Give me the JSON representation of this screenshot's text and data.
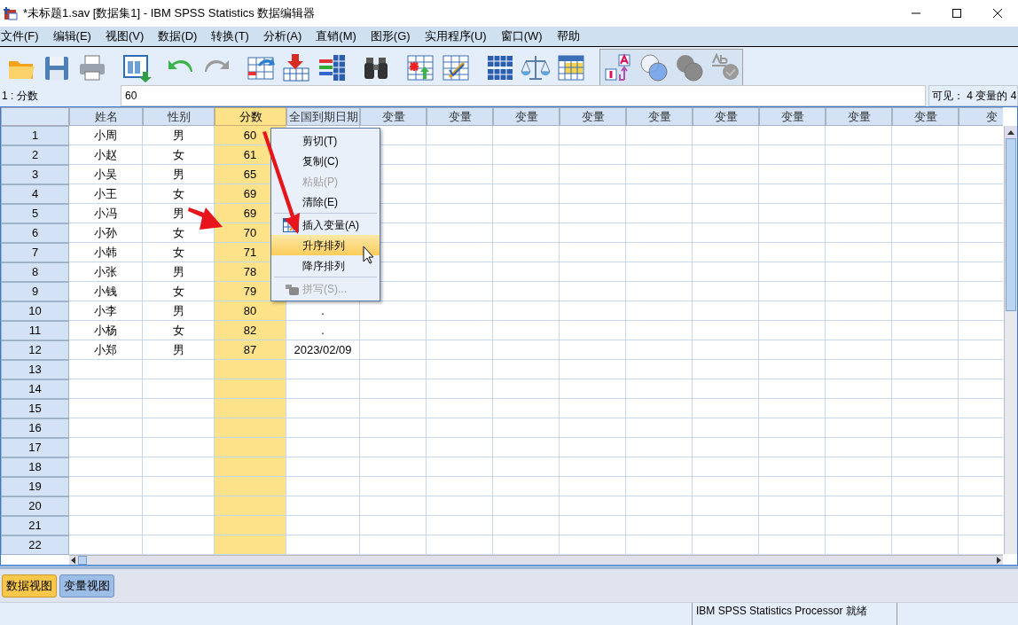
{
  "window": {
    "title": "*未标题1.sav [数据集1] - IBM SPSS Statistics 数据编辑器"
  },
  "menu_bar": [
    "文件(F)",
    "编辑(E)",
    "视图(V)",
    "数据(D)",
    "转换(T)",
    "分析(A)",
    "直销(M)",
    "图形(G)",
    "实用程序(U)",
    "窗口(W)",
    "帮助"
  ],
  "cell_editor": {
    "cell_reference": "1 : 分数",
    "value": "60",
    "visible_count": "可见： 4 变量的 4"
  },
  "grid": {
    "columns": [
      {
        "label": "姓名",
        "selected": false
      },
      {
        "label": "性别",
        "selected": false
      },
      {
        "label": "分数",
        "selected": true
      },
      {
        "label": "全国到期日期",
        "selected": false
      },
      {
        "label": "变量",
        "selected": false
      },
      {
        "label": "变量",
        "selected": false
      },
      {
        "label": "变量",
        "selected": false
      },
      {
        "label": "变量",
        "selected": false
      },
      {
        "label": "变量",
        "selected": false
      },
      {
        "label": "变量",
        "selected": false
      },
      {
        "label": "变量",
        "selected": false
      },
      {
        "label": "变量",
        "selected": false
      },
      {
        "label": "变量",
        "selected": false
      },
      {
        "label": "变",
        "selected": false
      }
    ],
    "rows": [
      {
        "number": "1",
        "cells": [
          "小周",
          "男",
          "60"
        ]
      },
      {
        "number": "2",
        "cells": [
          "小赵",
          "女",
          "61"
        ]
      },
      {
        "number": "3",
        "cells": [
          "小吴",
          "男",
          "65"
        ]
      },
      {
        "number": "4",
        "cells": [
          "小王",
          "女",
          "69"
        ]
      },
      {
        "number": "5",
        "cells": [
          "小冯",
          "男",
          "69"
        ]
      },
      {
        "number": "6",
        "cells": [
          "小孙",
          "女",
          "70"
        ]
      },
      {
        "number": "7",
        "cells": [
          "小韩",
          "女",
          "71"
        ]
      },
      {
        "number": "8",
        "cells": [
          "小张",
          "男",
          "78"
        ]
      },
      {
        "number": "9",
        "cells": [
          "小钱",
          "女",
          "79"
        ]
      },
      {
        "number": "10",
        "cells": [
          "小李",
          "男",
          "80",
          "."
        ]
      },
      {
        "number": "11",
        "cells": [
          "小杨",
          "女",
          "82",
          "."
        ]
      },
      {
        "number": "12",
        "cells": [
          "小郑",
          "男",
          "87",
          "2023/02/09"
        ]
      },
      {
        "number": "13",
        "cells": []
      },
      {
        "number": "14",
        "cells": []
      },
      {
        "number": "15",
        "cells": []
      },
      {
        "number": "16",
        "cells": []
      },
      {
        "number": "17",
        "cells": []
      },
      {
        "number": "18",
        "cells": []
      },
      {
        "number": "19",
        "cells": []
      },
      {
        "number": "20",
        "cells": []
      },
      {
        "number": "21",
        "cells": []
      },
      {
        "number": "22",
        "cells": []
      }
    ]
  },
  "context_menu": {
    "items": [
      {
        "kind": "item",
        "label": "剪切(T)",
        "disabled": false,
        "selected": false
      },
      {
        "kind": "item",
        "label": "复制(C)",
        "disabled": false,
        "selected": false
      },
      {
        "kind": "item",
        "label": "粘贴(P)",
        "disabled": true,
        "selected": false
      },
      {
        "kind": "item",
        "label": "清除(E)",
        "disabled": false,
        "selected": false
      },
      {
        "kind": "separator"
      },
      {
        "kind": "icon_item",
        "label": "插入变量(A)",
        "disabled": false,
        "selected": false
      },
      {
        "kind": "item",
        "label": "升序排列",
        "disabled": false,
        "selected": true
      },
      {
        "kind": "item",
        "label": "降序排列",
        "disabled": false,
        "selected": false
      },
      {
        "kind": "separator"
      },
      {
        "kind": "icon_item",
        "label": "拼写(S)...",
        "disabled": true,
        "selected": false
      }
    ]
  },
  "view_tabs": [
    {
      "label": "数据视图",
      "selected": true
    },
    {
      "label": "变量视图",
      "selected": false
    }
  ],
  "status_bar": {
    "processor_status": "IBM SPSS Statistics Processor 就绪"
  }
}
